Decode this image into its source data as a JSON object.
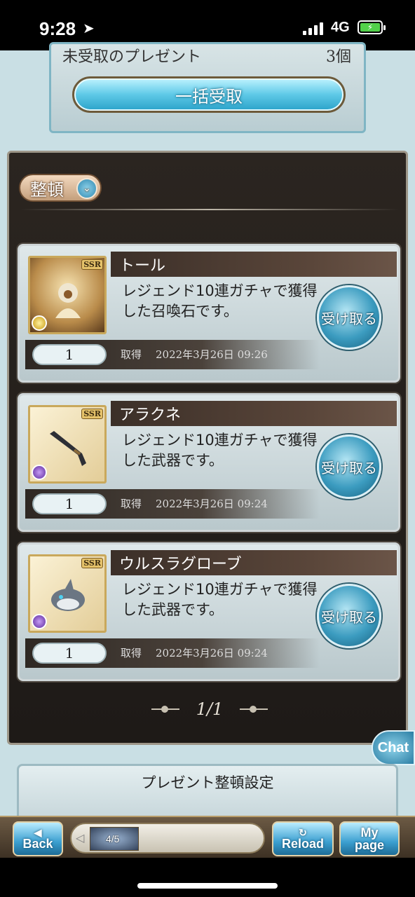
{
  "status_bar": {
    "time": "9:28",
    "network": "4G"
  },
  "bulk": {
    "count_label": "未受取のプレゼント",
    "count_value": "3個",
    "button_label": "一括受取"
  },
  "sort": {
    "label": "整頓"
  },
  "presents": [
    {
      "name": "トール",
      "description": "レジェンド10連ガチャで獲得した召喚石です。",
      "rarity": "SSR",
      "element": "light",
      "quantity": "1",
      "acquired_label": "取得",
      "acquired_date": "2022年3月26日 09:26",
      "receive_label": "受け取る"
    },
    {
      "name": "アラクネ",
      "description": "レジェンド10連ガチャで獲得した武器です。",
      "rarity": "SSR",
      "element": "dark",
      "quantity": "1",
      "acquired_label": "取得",
      "acquired_date": "2022年3月26日 09:24",
      "receive_label": "受け取る"
    },
    {
      "name": "ウルスラグローブ",
      "description": "レジェンド10連ガチャで獲得した武器です。",
      "rarity": "SSR",
      "element": "dark",
      "quantity": "1",
      "acquired_label": "取得",
      "acquired_date": "2022年3月26日 09:24",
      "receive_label": "受け取る"
    }
  ],
  "pager": {
    "text": "1/1"
  },
  "chat": {
    "label": "Chat"
  },
  "settings": {
    "title": "プレゼント整頓設定"
  },
  "bottom_nav": {
    "back_label": "Back",
    "party_label": "4/5",
    "reload_label": "Reload",
    "mypage_line1": "My",
    "mypage_line2": "page"
  },
  "colors": {
    "accent_blue": "#3c9cc0",
    "panel_dark": "#2b2520",
    "gold_frame": "#c9a85b"
  }
}
